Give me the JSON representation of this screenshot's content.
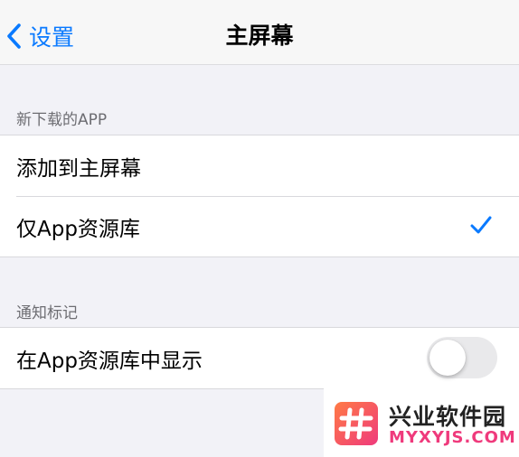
{
  "nav": {
    "back_label": "设置",
    "title": "主屏幕"
  },
  "section_new_apps": {
    "header": "新下载的APP",
    "options": [
      {
        "label": "添加到主屏幕",
        "selected": false
      },
      {
        "label": "仅App资源库",
        "selected": true
      }
    ]
  },
  "section_badges": {
    "header": "通知标记",
    "toggle_label": "在App资源库中显示",
    "toggle_on": false
  },
  "watermark": {
    "name": "兴业软件园",
    "url": "MYXYJS.COM"
  },
  "colors": {
    "accent": "#0a7aff",
    "background": "#f2f2f7",
    "watermark_pink": "#ef3a7c"
  }
}
